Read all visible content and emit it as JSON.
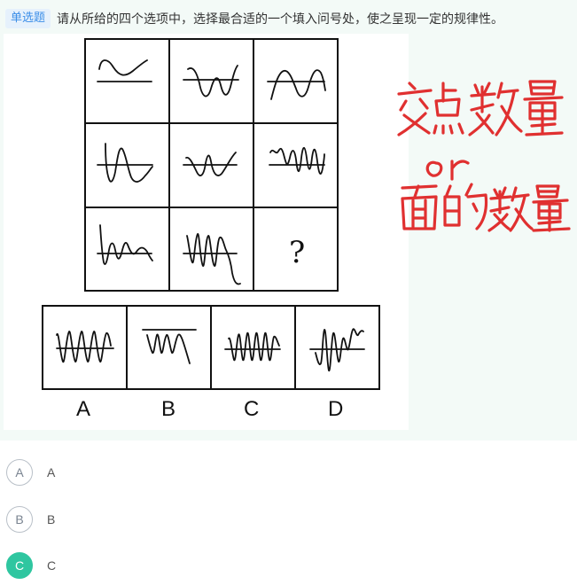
{
  "question": {
    "type_tag": "单选题",
    "prompt": "请从所给的四个选项中，选择最合适的一个填入问号处，使之呈现一定的规律性。",
    "missing_mark": "?",
    "option_labels": [
      "A",
      "B",
      "C",
      "D"
    ]
  },
  "annotation": {
    "lines": [
      "交点数量",
      "or",
      "面的数量"
    ],
    "color": "#e03030"
  },
  "answers": [
    {
      "letter": "A",
      "text": "A",
      "selected": false
    },
    {
      "letter": "B",
      "text": "B",
      "selected": false
    },
    {
      "letter": "C",
      "text": "C",
      "selected": true
    }
  ],
  "colors": {
    "accent": "#2fc6a0",
    "tag_bg": "#e6f1fc",
    "tag_text": "#3b8ee8",
    "question_bg": "#f3faf7"
  }
}
